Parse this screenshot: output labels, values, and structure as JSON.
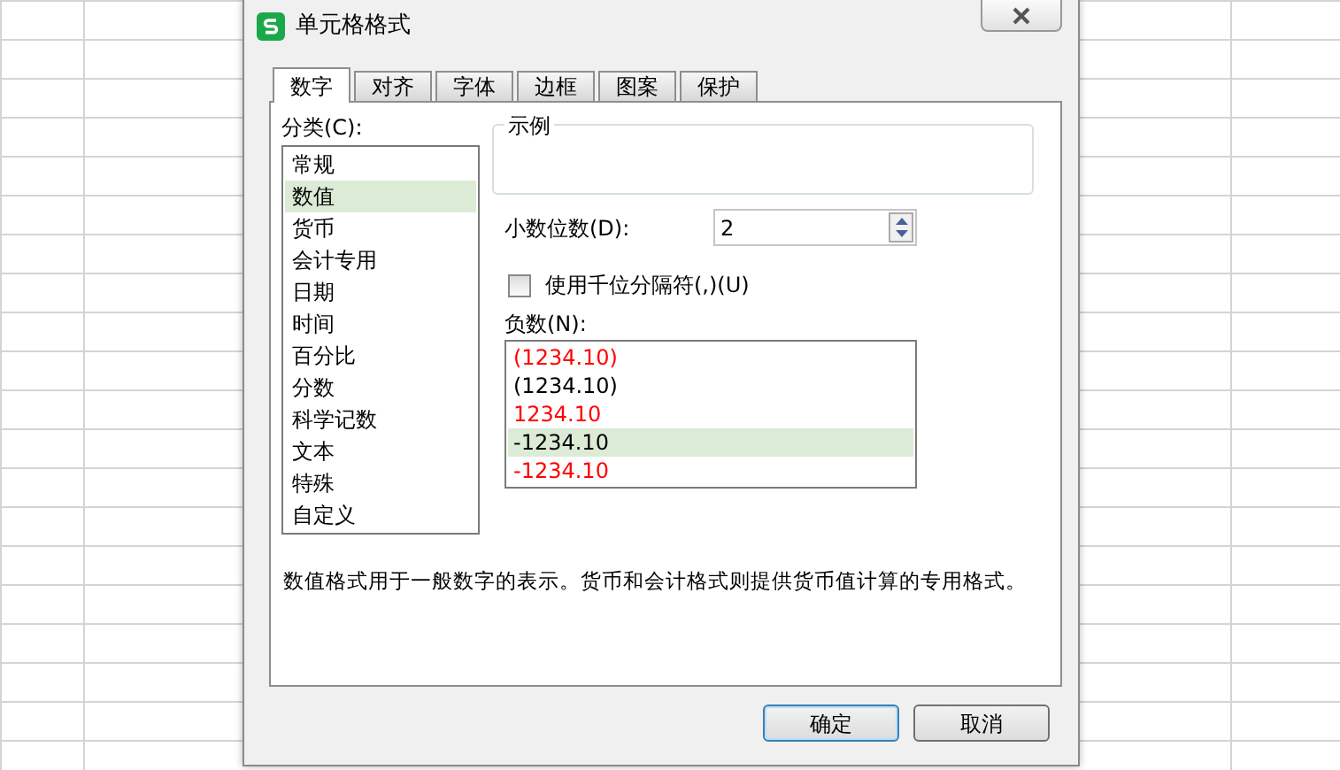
{
  "window": {
    "title": "单元格格式"
  },
  "tabs": [
    {
      "label": "数字",
      "selected": true
    },
    {
      "label": "对齐",
      "selected": false
    },
    {
      "label": "字体",
      "selected": false
    },
    {
      "label": "边框",
      "selected": false
    },
    {
      "label": "图案",
      "selected": false
    },
    {
      "label": "保护",
      "selected": false
    }
  ],
  "category": {
    "label": "分类(C):",
    "items": [
      {
        "label": "常规",
        "selected": false
      },
      {
        "label": "数值",
        "selected": true
      },
      {
        "label": "货币",
        "selected": false
      },
      {
        "label": "会计专用",
        "selected": false
      },
      {
        "label": "日期",
        "selected": false
      },
      {
        "label": "时间",
        "selected": false
      },
      {
        "label": "百分比",
        "selected": false
      },
      {
        "label": "分数",
        "selected": false
      },
      {
        "label": "科学记数",
        "selected": false
      },
      {
        "label": "文本",
        "selected": false
      },
      {
        "label": "特殊",
        "selected": false
      },
      {
        "label": "自定义",
        "selected": false
      }
    ]
  },
  "sample": {
    "label": "示例"
  },
  "decimal_places": {
    "label": "小数位数(D):",
    "value": "2"
  },
  "thousands_separator": {
    "label": "使用千位分隔符(,)(U)",
    "checked": false
  },
  "negative_numbers": {
    "label": "负数(N):",
    "items": [
      {
        "label": "(1234.10)",
        "color": "#ff0000",
        "selected": false
      },
      {
        "label": "(1234.10)",
        "color": "#000000",
        "selected": false
      },
      {
        "label": "1234.10",
        "color": "#ff0000",
        "selected": false
      },
      {
        "label": "-1234.10",
        "color": "#000000",
        "selected": true
      },
      {
        "label": "-1234.10",
        "color": "#ff0000",
        "selected": false
      }
    ]
  },
  "description": "数值格式用于一般数字的表示。货币和会计格式则提供货币值计算的专用格式。",
  "buttons": [
    "确定",
    "取消"
  ]
}
